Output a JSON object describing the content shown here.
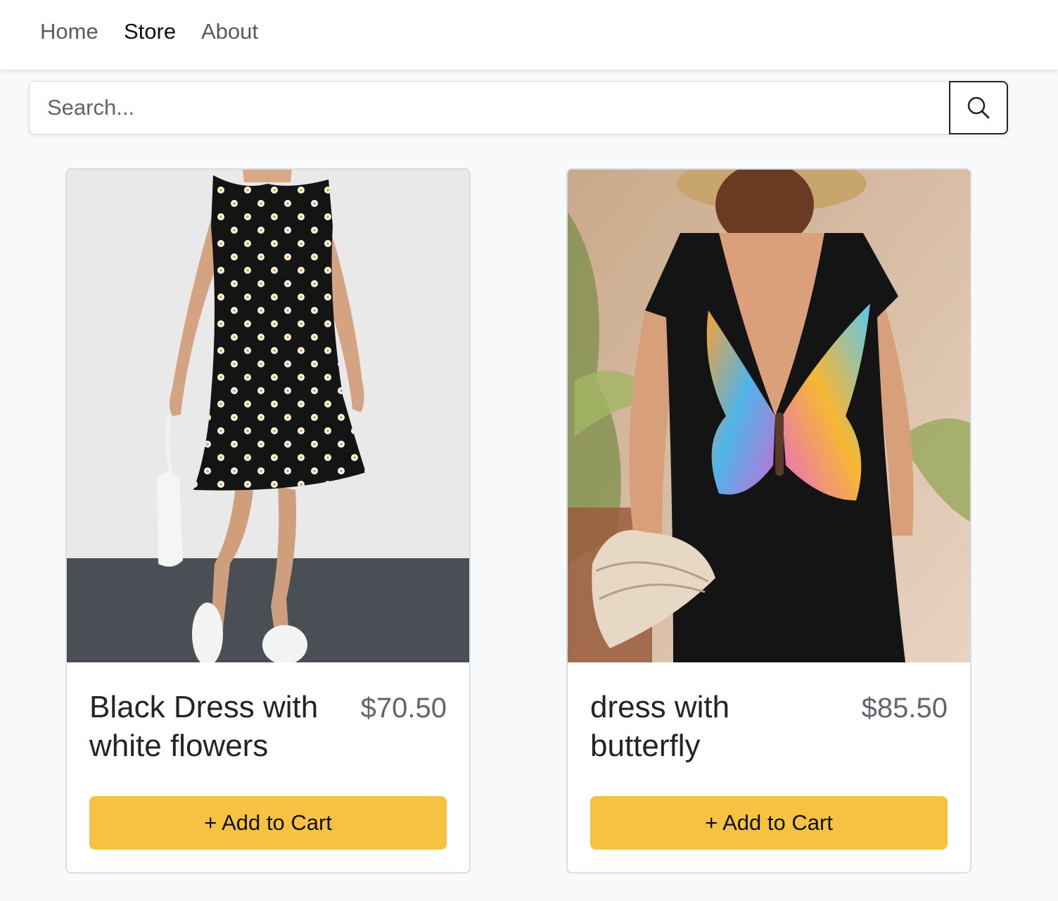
{
  "nav": {
    "items": [
      {
        "label": "Home",
        "active": false
      },
      {
        "label": "Store",
        "active": true
      },
      {
        "label": "About",
        "active": false
      }
    ]
  },
  "search": {
    "placeholder": "Search...",
    "value": "",
    "button_icon": "search-icon"
  },
  "products": [
    {
      "name": "Black Dress with white flowers",
      "price": "$70.50",
      "button_label": "+ Add to Cart",
      "image_icon": "product-photo-black-floral-dress"
    },
    {
      "name": "dress with butterfly",
      "price": "$85.50",
      "button_label": "+ Add to Cart",
      "image_icon": "product-photo-butterfly-back-dress"
    }
  ],
  "colors": {
    "accent": "#f5c242",
    "page_background": "#f8f9fa",
    "price_text": "#5f656b"
  }
}
